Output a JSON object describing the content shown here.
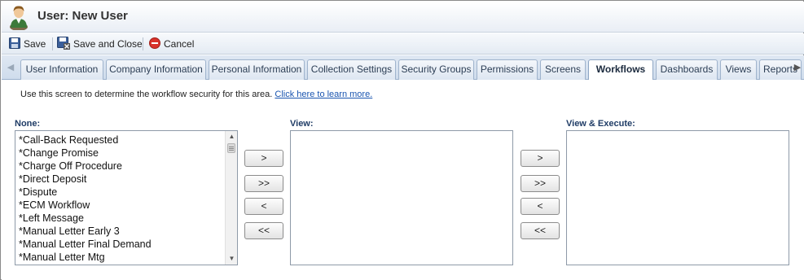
{
  "window": {
    "title": "User: New User",
    "icon": "user-icon"
  },
  "toolbar": {
    "save_label": "Save",
    "save_close_label": "Save and Close",
    "cancel_label": "Cancel"
  },
  "tabs": {
    "items": [
      {
        "label": "User Information"
      },
      {
        "label": "Company Information"
      },
      {
        "label": "Personal Information"
      },
      {
        "label": "Collection Settings"
      },
      {
        "label": "Security Groups"
      },
      {
        "label": "Permissions"
      },
      {
        "label": "Screens"
      },
      {
        "label": "Workflows"
      },
      {
        "label": "Dashboards"
      },
      {
        "label": "Views"
      },
      {
        "label": "Reports"
      }
    ],
    "active": "Workflows"
  },
  "content": {
    "info_text": "Use this screen to determine the workflow security for this area.",
    "learn_more_link": "Click here to learn more."
  },
  "lists": {
    "none": {
      "label": "None:",
      "items": [
        "*Call-Back Requested",
        "*Change Promise",
        "*Charge Off Procedure",
        "*Direct Deposit",
        "*Dispute",
        "*ECM Workflow",
        "*Left Message",
        "*Manual Letter Early 3",
        "*Manual Letter Final Demand",
        "*Manual Letter Mtg"
      ]
    },
    "view": {
      "label": "View:",
      "items": []
    },
    "view_execute": {
      "label": "View & Execute:",
      "items": []
    }
  },
  "move_buttons": {
    "move_right": ">",
    "move_all_right": ">>",
    "move_left": "<",
    "move_all_left": "<<"
  },
  "colors": {
    "section_label": "#1f3c66",
    "link": "#1a55b0",
    "cancel_icon": "#d9322b"
  }
}
